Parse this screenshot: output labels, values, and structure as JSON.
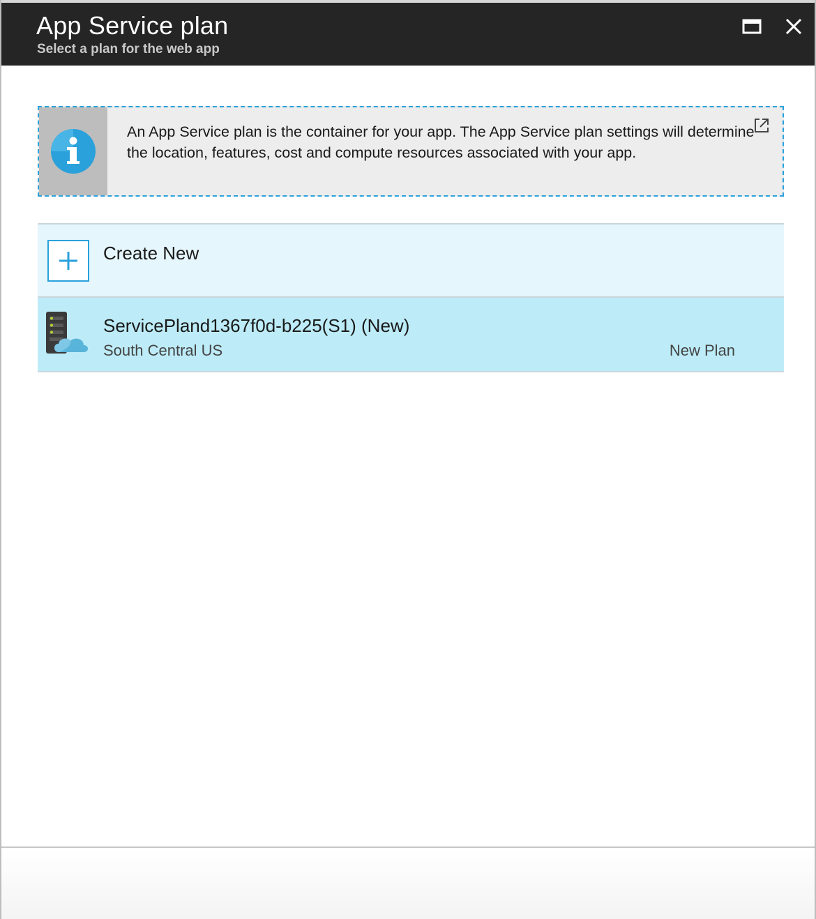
{
  "header": {
    "title": "App Service plan",
    "subtitle": "Select a plan for the web app"
  },
  "info": {
    "text": "An App Service plan is the container for your app. The App Service plan settings will determine the location, features, cost and compute resources associated with your app.",
    "icon": "info-icon",
    "link_icon": "external-link-icon"
  },
  "list": {
    "create_new_label": "Create New",
    "plans": [
      {
        "name": "ServicePland1367f0d-b225(S1) (New)",
        "region": "South Central US",
        "tag": "New Plan",
        "icon": "app-service-plan-icon"
      }
    ]
  },
  "colors": {
    "accent": "#2aa1db",
    "header_bg": "#252525",
    "create_row_bg": "#e5f6fc",
    "selected_row_bg": "#bdecf8"
  }
}
